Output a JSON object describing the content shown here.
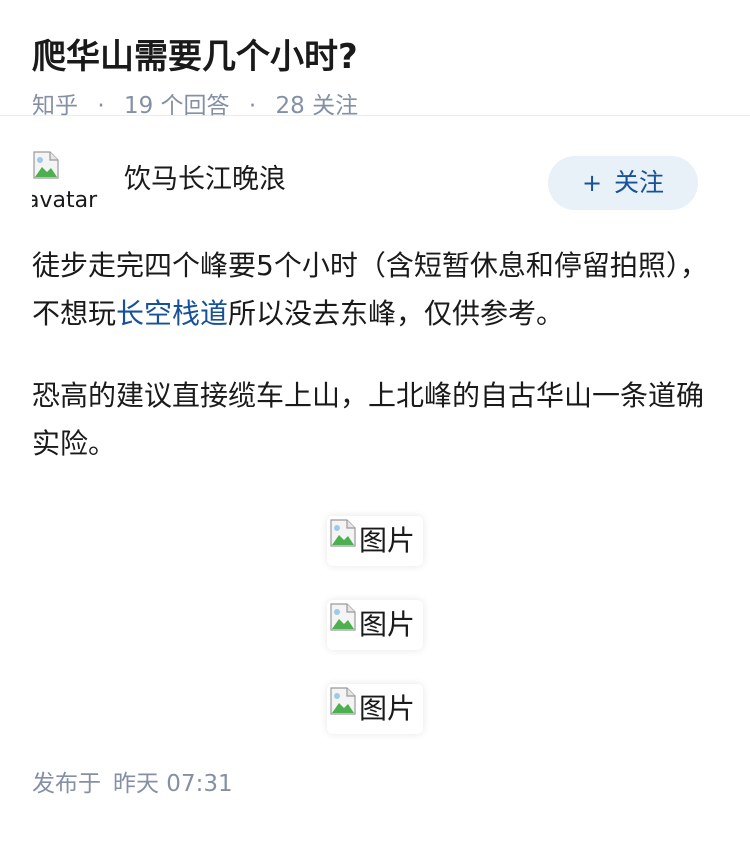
{
  "question": {
    "title": "爬华山需要几个小时?",
    "source": "知乎",
    "answer_count": "19",
    "answer_count_label": "个回答",
    "follower_count": "28",
    "follower_count_label": "关注"
  },
  "answer": {
    "author": {
      "avatar_alt": "avatar",
      "name": "饮马长江晚浪",
      "follow_label": "关注",
      "follow_icon": "plus-icon"
    },
    "paragraphs": [
      {
        "before": "徒步走完四个峰要5个小时（含短暂休息和停留拍照），不想玩",
        "link": "长空栈道",
        "after": "所以没去东峰，仅供参考。"
      },
      {
        "text": "恐高的建议直接缆车上山，上北峰的自古华山一条道确实险。"
      }
    ],
    "images": [
      {
        "alt": "图片"
      },
      {
        "alt": "图片"
      },
      {
        "alt": "图片"
      }
    ],
    "published_label": "发布于",
    "published_time": "昨天 07:31"
  },
  "colors": {
    "link": "#175199",
    "meta": "#8590a6",
    "follow_bg": "#e8f0f8"
  }
}
